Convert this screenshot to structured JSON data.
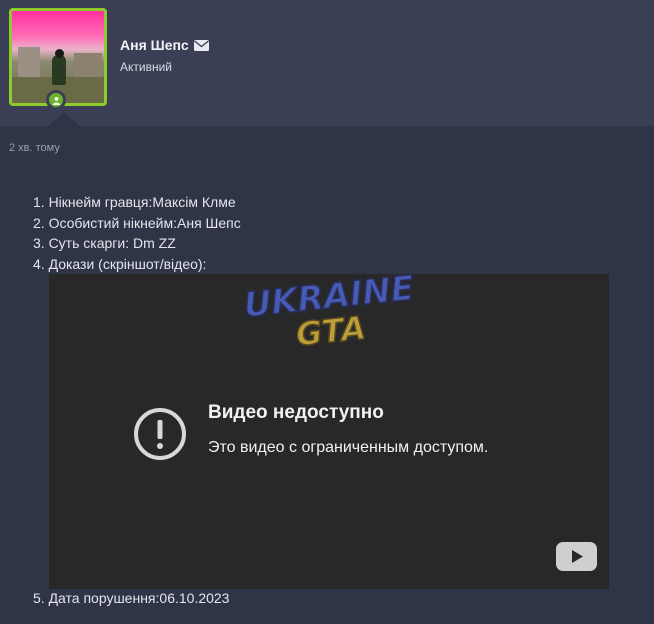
{
  "profile": {
    "username": "Аня Шепс",
    "status": "Активний",
    "avatar_border_color": "#8fcb2b",
    "online_indicator_color": "#6ab42e"
  },
  "post": {
    "time": "2 хв. тому",
    "lines": [
      "1. Нікнейм гравця:Максім Клме",
      "2. Особистий нікнейм:Аня Шепс",
      "3. Суть скарги: Dm ZZ",
      "4. Докази (скріншот/відео):"
    ],
    "date_line": "5. Дата порушення:06.10.2023"
  },
  "video": {
    "title": "Видео недоступно",
    "message": "Это видео с ограниченным доступом.",
    "icon": "alert-circle-icon",
    "button_icon": "youtube-play-icon"
  },
  "watermark": {
    "line1": "UKRAINE",
    "line2": "GTA"
  },
  "icons": {
    "mail": "envelope-icon",
    "online": "user-online-icon"
  }
}
